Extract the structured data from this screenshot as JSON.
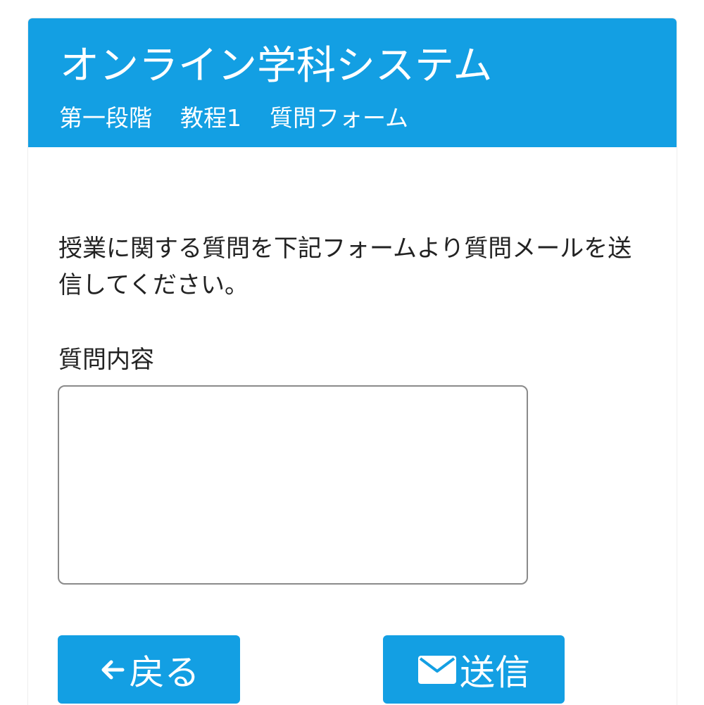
{
  "header": {
    "title": "オンライン学科システム",
    "breadcrumb": [
      "第一段階",
      "教程1",
      "質問フォーム"
    ]
  },
  "main": {
    "intro_text": "授業に関する質問を下記フォームより質問メールを送信してください。",
    "question_label": "質問内容",
    "question_value": "",
    "question_placeholder": ""
  },
  "actions": {
    "back_label": "戻る",
    "back_icon": "arrow-left-icon",
    "send_label": "送信",
    "send_icon": "envelope-icon"
  },
  "colors": {
    "primary": "#139fe3",
    "text": "#222222",
    "border": "#8a8a8a"
  }
}
